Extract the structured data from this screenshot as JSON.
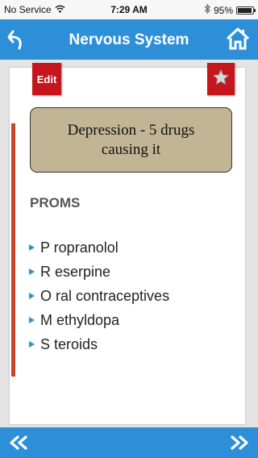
{
  "status_bar": {
    "carrier": "No Service",
    "time": "7:29 AM",
    "battery": "95%",
    "battery_level": 0.95
  },
  "navbar": {
    "title": "Nervous System",
    "back_icon": "back-arrow-icon",
    "home_icon": "home-icon"
  },
  "card": {
    "edit_label": "Edit",
    "star_icon": "star-icon",
    "question": "Depression - 5 drugs causing it",
    "mnemonic": "PROMS",
    "items": [
      "P ropranolol",
      "R eserpine",
      "O ral contraceptives",
      "M ethyldopa",
      "S teroids"
    ]
  },
  "bottom_bar": {
    "prev_icon": "double-chevron-left-icon",
    "next_icon": "double-chevron-right-icon"
  },
  "colors": {
    "nav_blue": "#2d8fd8",
    "tag_red": "#c5161d",
    "accent_bar": "#c9442c",
    "question_bg": "#c1b595"
  }
}
